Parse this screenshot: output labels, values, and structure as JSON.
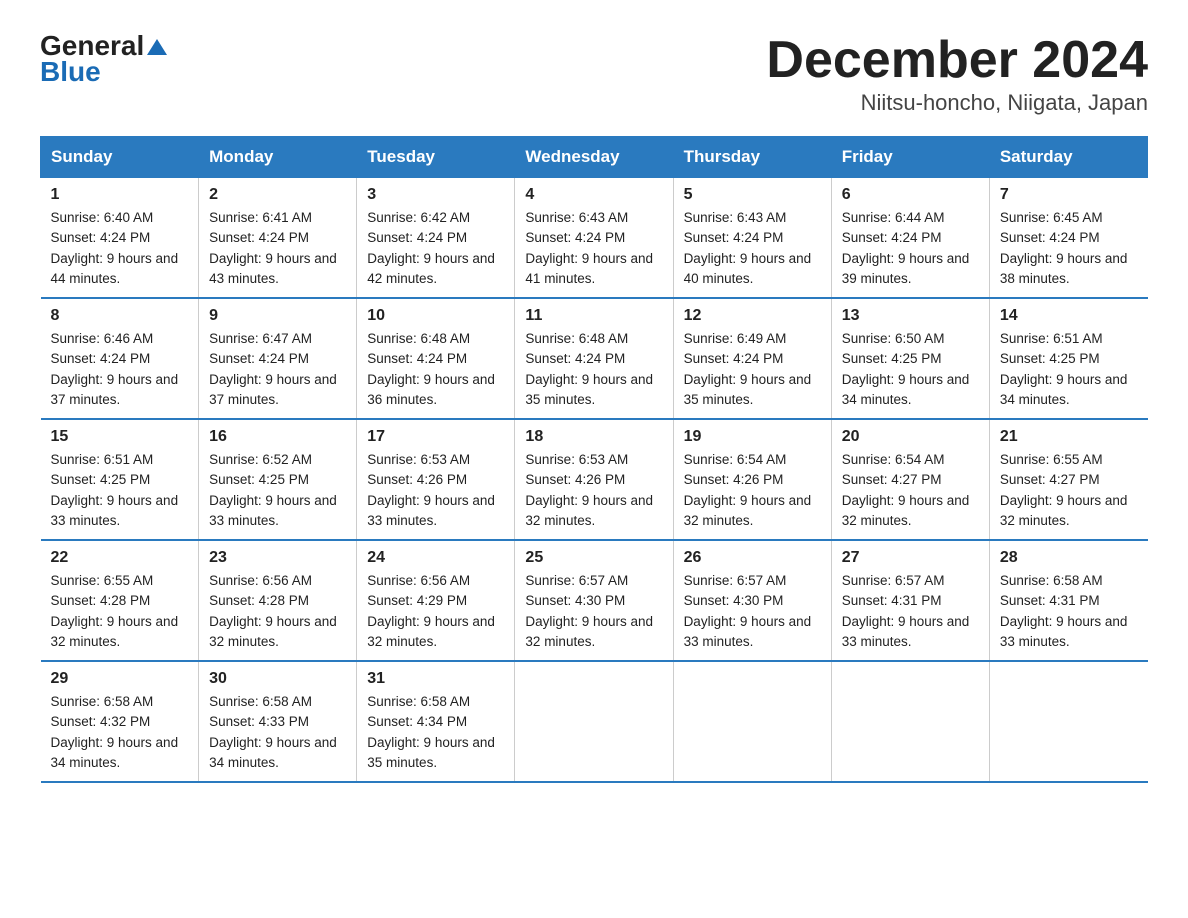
{
  "header": {
    "logo_general": "General",
    "logo_blue": "Blue",
    "month_title": "December 2024",
    "location": "Niitsu-honcho, Niigata, Japan"
  },
  "days_of_week": [
    "Sunday",
    "Monday",
    "Tuesday",
    "Wednesday",
    "Thursday",
    "Friday",
    "Saturday"
  ],
  "weeks": [
    [
      {
        "day": 1,
        "sunrise": "6:40 AM",
        "sunset": "4:24 PM",
        "daylight": "9 hours and 44 minutes."
      },
      {
        "day": 2,
        "sunrise": "6:41 AM",
        "sunset": "4:24 PM",
        "daylight": "9 hours and 43 minutes."
      },
      {
        "day": 3,
        "sunrise": "6:42 AM",
        "sunset": "4:24 PM",
        "daylight": "9 hours and 42 minutes."
      },
      {
        "day": 4,
        "sunrise": "6:43 AM",
        "sunset": "4:24 PM",
        "daylight": "9 hours and 41 minutes."
      },
      {
        "day": 5,
        "sunrise": "6:43 AM",
        "sunset": "4:24 PM",
        "daylight": "9 hours and 40 minutes."
      },
      {
        "day": 6,
        "sunrise": "6:44 AM",
        "sunset": "4:24 PM",
        "daylight": "9 hours and 39 minutes."
      },
      {
        "day": 7,
        "sunrise": "6:45 AM",
        "sunset": "4:24 PM",
        "daylight": "9 hours and 38 minutes."
      }
    ],
    [
      {
        "day": 8,
        "sunrise": "6:46 AM",
        "sunset": "4:24 PM",
        "daylight": "9 hours and 37 minutes."
      },
      {
        "day": 9,
        "sunrise": "6:47 AM",
        "sunset": "4:24 PM",
        "daylight": "9 hours and 37 minutes."
      },
      {
        "day": 10,
        "sunrise": "6:48 AM",
        "sunset": "4:24 PM",
        "daylight": "9 hours and 36 minutes."
      },
      {
        "day": 11,
        "sunrise": "6:48 AM",
        "sunset": "4:24 PM",
        "daylight": "9 hours and 35 minutes."
      },
      {
        "day": 12,
        "sunrise": "6:49 AM",
        "sunset": "4:24 PM",
        "daylight": "9 hours and 35 minutes."
      },
      {
        "day": 13,
        "sunrise": "6:50 AM",
        "sunset": "4:25 PM",
        "daylight": "9 hours and 34 minutes."
      },
      {
        "day": 14,
        "sunrise": "6:51 AM",
        "sunset": "4:25 PM",
        "daylight": "9 hours and 34 minutes."
      }
    ],
    [
      {
        "day": 15,
        "sunrise": "6:51 AM",
        "sunset": "4:25 PM",
        "daylight": "9 hours and 33 minutes."
      },
      {
        "day": 16,
        "sunrise": "6:52 AM",
        "sunset": "4:25 PM",
        "daylight": "9 hours and 33 minutes."
      },
      {
        "day": 17,
        "sunrise": "6:53 AM",
        "sunset": "4:26 PM",
        "daylight": "9 hours and 33 minutes."
      },
      {
        "day": 18,
        "sunrise": "6:53 AM",
        "sunset": "4:26 PM",
        "daylight": "9 hours and 32 minutes."
      },
      {
        "day": 19,
        "sunrise": "6:54 AM",
        "sunset": "4:26 PM",
        "daylight": "9 hours and 32 minutes."
      },
      {
        "day": 20,
        "sunrise": "6:54 AM",
        "sunset": "4:27 PM",
        "daylight": "9 hours and 32 minutes."
      },
      {
        "day": 21,
        "sunrise": "6:55 AM",
        "sunset": "4:27 PM",
        "daylight": "9 hours and 32 minutes."
      }
    ],
    [
      {
        "day": 22,
        "sunrise": "6:55 AM",
        "sunset": "4:28 PM",
        "daylight": "9 hours and 32 minutes."
      },
      {
        "day": 23,
        "sunrise": "6:56 AM",
        "sunset": "4:28 PM",
        "daylight": "9 hours and 32 minutes."
      },
      {
        "day": 24,
        "sunrise": "6:56 AM",
        "sunset": "4:29 PM",
        "daylight": "9 hours and 32 minutes."
      },
      {
        "day": 25,
        "sunrise": "6:57 AM",
        "sunset": "4:30 PM",
        "daylight": "9 hours and 32 minutes."
      },
      {
        "day": 26,
        "sunrise": "6:57 AM",
        "sunset": "4:30 PM",
        "daylight": "9 hours and 33 minutes."
      },
      {
        "day": 27,
        "sunrise": "6:57 AM",
        "sunset": "4:31 PM",
        "daylight": "9 hours and 33 minutes."
      },
      {
        "day": 28,
        "sunrise": "6:58 AM",
        "sunset": "4:31 PM",
        "daylight": "9 hours and 33 minutes."
      }
    ],
    [
      {
        "day": 29,
        "sunrise": "6:58 AM",
        "sunset": "4:32 PM",
        "daylight": "9 hours and 34 minutes."
      },
      {
        "day": 30,
        "sunrise": "6:58 AM",
        "sunset": "4:33 PM",
        "daylight": "9 hours and 34 minutes."
      },
      {
        "day": 31,
        "sunrise": "6:58 AM",
        "sunset": "4:34 PM",
        "daylight": "9 hours and 35 minutes."
      },
      null,
      null,
      null,
      null
    ]
  ]
}
